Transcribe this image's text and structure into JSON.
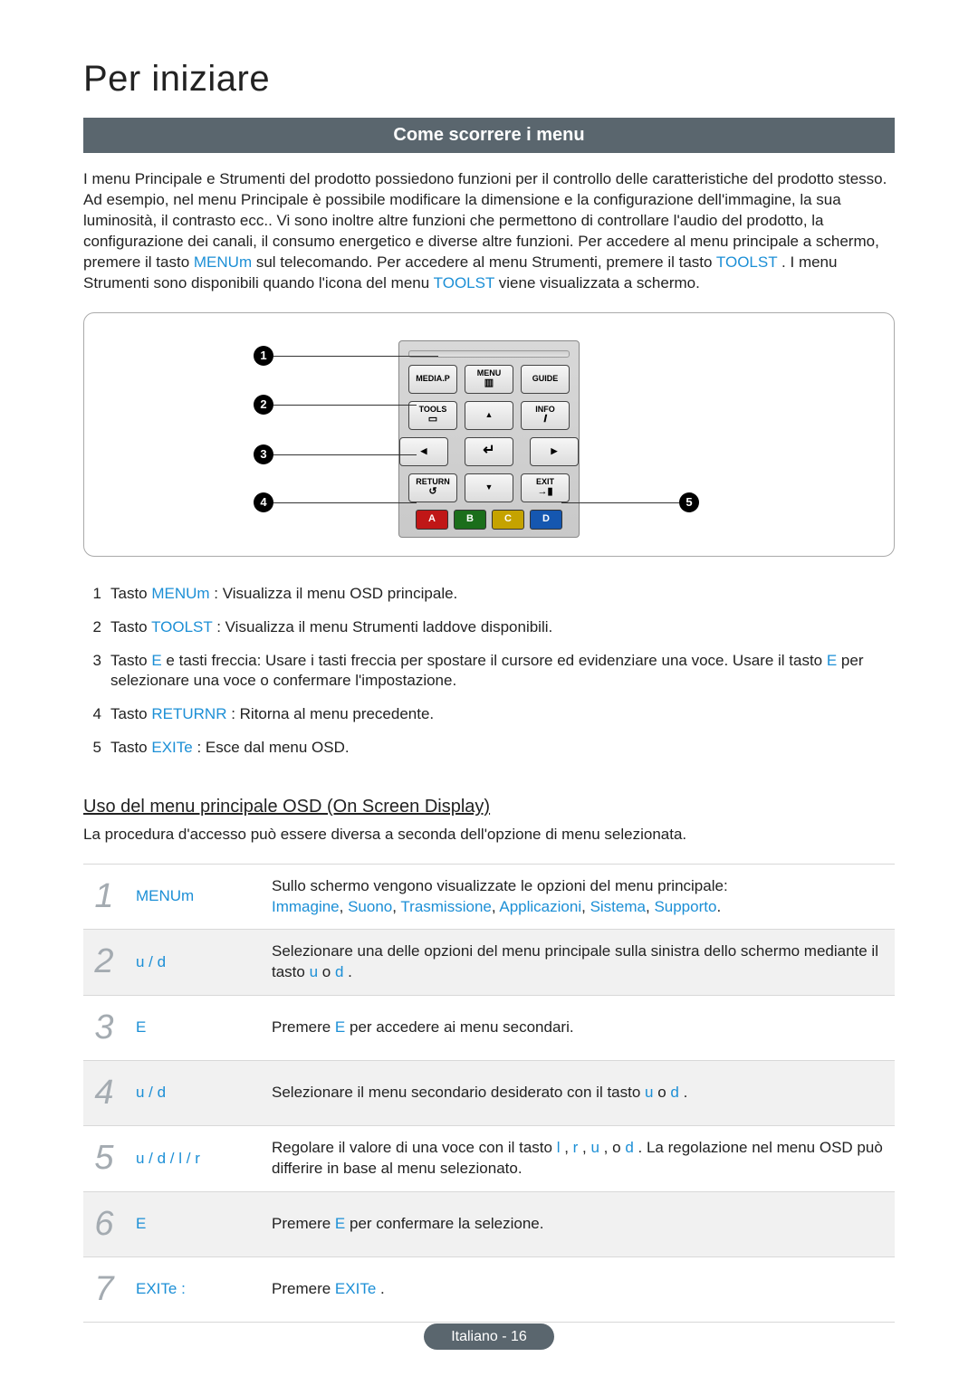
{
  "page": {
    "title": "Per iniziare",
    "section_bar": "Come scorrere i menu",
    "intro_parts": [
      "I menu Principale e Strumenti del prodotto possiedono funzioni per il controllo delle caratteristiche del prodotto stesso. Ad esempio, nel menu Principale è possibile modificare la dimensione e la configurazione dell'immagine, la sua luminosità, il contrasto ecc.. Vi sono inoltre altre funzioni che permettono di controllare l'audio del prodotto, la configurazione dei canali, il consumo energetico e diverse altre funzioni. Per accedere al menu principale a schermo, premere il tasto ",
      "MENUm",
      " sul telecomando. Per accedere al menu Strumenti, premere il tasto ",
      "TOOLST",
      " . I menu Strumenti sono disponibili quando l'icona del menu ",
      "TOOLST",
      " viene visualizzata a schermo."
    ],
    "remote": {
      "buttons": {
        "media_p": "MEDIA.P",
        "menu": "MENU",
        "guide": "GUIDE",
        "tools": "TOOLS",
        "info": "INFO",
        "return": "RETURN",
        "exit": "EXIT",
        "up": "▲",
        "down": "▼",
        "left": "◀",
        "right": "▶",
        "enter": "↵",
        "a": "A",
        "b": "B",
        "c": "C",
        "d": "D"
      },
      "callouts": {
        "c1": "1",
        "c2": "2",
        "c3": "3",
        "c4": "4",
        "c5": "5"
      }
    },
    "legend": [
      {
        "n": "1",
        "pre": "Tasto ",
        "key": "MENUm",
        "post": " : Visualizza il menu OSD principale."
      },
      {
        "n": "2",
        "pre": "Tasto ",
        "key": "TOOLST",
        "post": " : Visualizza il menu Strumenti laddove disponibili."
      },
      {
        "n": "3",
        "pre": "Tasto ",
        "key": "E",
        "mid_a": " e tasti freccia: Usare i tasti freccia per spostare il cursore ed evidenziare una voce. Usare il tasto ",
        "key2": "E",
        "post": " per selezionare una voce o confermare l'impostazione."
      },
      {
        "n": "4",
        "pre": "Tasto ",
        "key": "RETURNR",
        "post": " : Ritorna al menu precedente."
      },
      {
        "n": "5",
        "pre": "Tasto ",
        "key": "EXITe",
        "post": " : Esce dal menu OSD."
      }
    ],
    "osd": {
      "heading": "Uso del menu principale OSD (On Screen Display)",
      "sub": "La procedura d'accesso può essere diversa a seconda dell'opzione di menu selezionata.",
      "steps": [
        {
          "num": "1",
          "key": "MENUm",
          "desc_a": "Sullo schermo vengono visualizzate le opzioni del menu principale:",
          "desc_list": [
            "Immagine",
            "Suono",
            "Trasmissione",
            "Applicazioni",
            "Sistema",
            "Supporto"
          ],
          "desc_b_suffix": "."
        },
        {
          "num": "2",
          "key": "u / d",
          "desc_a": "Selezionare una delle opzioni del menu principale sulla sinistra dello schermo mediante il tasto ",
          "inline_keys": [
            "u",
            " o ",
            "d"
          ],
          "desc_suffix": " ."
        },
        {
          "num": "3",
          "key": "E",
          "desc_a": "Premere ",
          "inline_keys": [
            "E"
          ],
          "desc_suffix": " per accedere ai menu secondari."
        },
        {
          "num": "4",
          "key": "u / d",
          "desc_a": "Selezionare il menu secondario desiderato con il tasto ",
          "inline_keys": [
            "u",
            " o ",
            "d"
          ],
          "desc_suffix": " ."
        },
        {
          "num": "5",
          "key": "u / d / l / r",
          "desc_a": "Regolare il valore di una voce con il tasto ",
          "inline_keys": [
            "l",
            " , ",
            "r",
            " , ",
            "u",
            " , o ",
            "d"
          ],
          "desc_suffix": " . La regolazione nel menu OSD può differire in base al menu selezionato."
        },
        {
          "num": "6",
          "key": "E",
          "desc_a": "Premere ",
          "inline_keys": [
            "E"
          ],
          "desc_suffix": " per confermare la selezione."
        },
        {
          "num": "7",
          "key": "EXITe  :",
          "desc_a": "Premere ",
          "inline_keys": [
            "EXITe"
          ],
          "desc_suffix": " ."
        }
      ]
    },
    "footer": "Italiano - 16"
  }
}
